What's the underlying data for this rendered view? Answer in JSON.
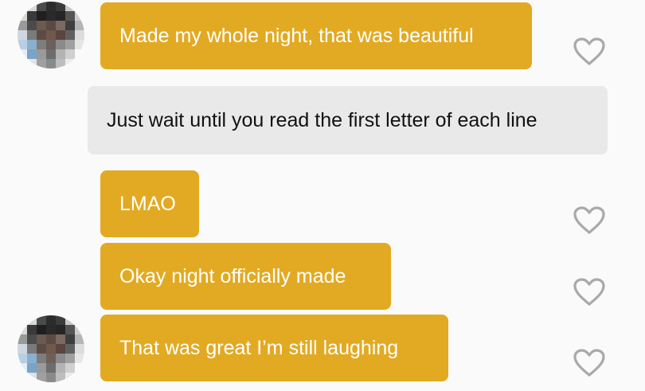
{
  "conversation": {
    "messages": [
      {
        "text": "Made my whole night, that was beautiful",
        "sender": "them"
      },
      {
        "text": "Just wait until you read the first letter of each line",
        "sender": "me"
      },
      {
        "text": "LMAO",
        "sender": "them"
      },
      {
        "text": "Okay night officially made",
        "sender": "them"
      },
      {
        "text": "That was great I’m still laughing",
        "sender": "them"
      }
    ]
  },
  "colors": {
    "incoming_bubble": "#e2aa23",
    "outgoing_bubble": "#e9e9e9",
    "heart_outline": "#a9a9a9",
    "background": "#fafafa"
  },
  "icons": {
    "like": "heart-outline-icon",
    "avatar": "pixelated-avatar"
  }
}
